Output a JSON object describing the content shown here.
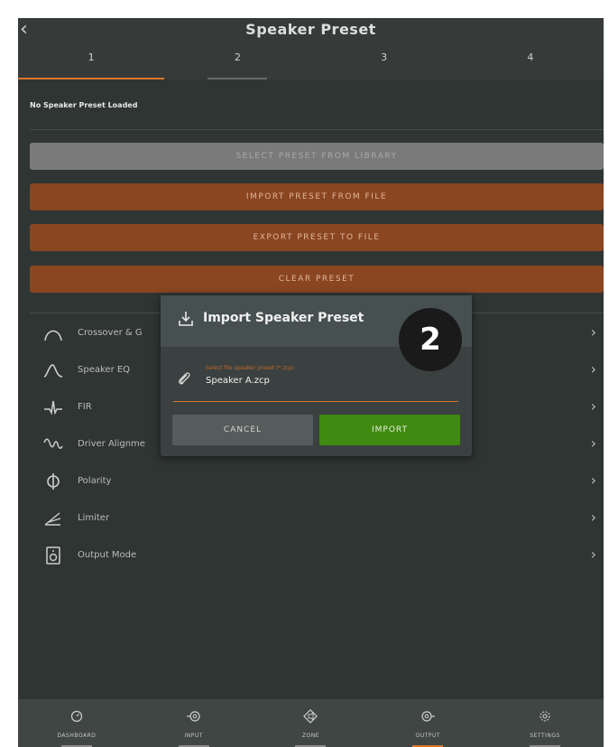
{
  "header": {
    "title": "Speaker Preset",
    "back_icon": "chevron-left-icon"
  },
  "tabs": [
    {
      "label": "1"
    },
    {
      "label": "2"
    },
    {
      "label": "3"
    },
    {
      "label": "4"
    }
  ],
  "status": "No Speaker Preset Loaded",
  "actions": {
    "select_library": "SELECT PRESET FROM LIBRARY",
    "import_file": "IMPORT PRESET FROM FILE",
    "export_file": "EXPORT PRESET TO FILE",
    "clear": "CLEAR PRESET"
  },
  "menu": [
    {
      "label": "Crossover & G",
      "icon": "crossover-icon"
    },
    {
      "label": "Speaker EQ",
      "icon": "eq-curve-icon"
    },
    {
      "label": "FIR",
      "icon": "fir-icon"
    },
    {
      "label": "Driver Alignme",
      "icon": "alignment-icon"
    },
    {
      "label": "Polarity",
      "icon": "polarity-icon"
    },
    {
      "label": "Limiter",
      "icon": "limiter-icon"
    },
    {
      "label": "Output Mode",
      "icon": "speaker-icon"
    }
  ],
  "dialog": {
    "title": "Import Speaker Preset",
    "field_label": "Select file speaker preset (*.zcp)",
    "field_value": "Speaker A.zcp",
    "cancel": "CANCEL",
    "import": "IMPORT"
  },
  "badge": "2",
  "bottom_nav": [
    {
      "label": "DASHBOARD",
      "icon": "gauge-icon"
    },
    {
      "label": "INPUT",
      "icon": "input-icon"
    },
    {
      "label": "ZONE",
      "icon": "zone-icon"
    },
    {
      "label": "OUTPUT",
      "icon": "output-icon"
    },
    {
      "label": "SETTINGS",
      "icon": "gear-icon"
    }
  ],
  "colors": {
    "accent": "#d9742a",
    "import_green": "#3f8a10",
    "button_orange": "#8a4521"
  }
}
